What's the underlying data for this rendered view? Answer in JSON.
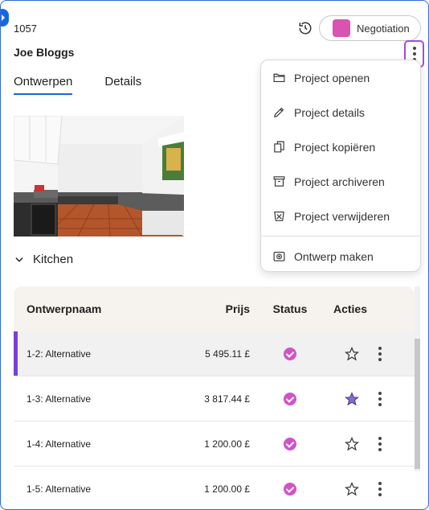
{
  "header": {
    "project_number": "1057",
    "client_name": "Joe Bloggs",
    "status_label": "Negotiation",
    "status_color": "#d953b3"
  },
  "tabs": [
    {
      "label": "Ontwerpen",
      "active": true
    },
    {
      "label": "Details",
      "active": false
    }
  ],
  "section": {
    "label": "Kitchen"
  },
  "table": {
    "columns": [
      "Ontwerpnaam",
      "Prijs",
      "Status",
      "Acties"
    ],
    "rows": [
      {
        "name": "1-2: Alternative",
        "price": "5 495.11 £",
        "selected": true,
        "starred": false
      },
      {
        "name": "1-3: Alternative",
        "price": "3 817.44 £",
        "selected": false,
        "starred": true
      },
      {
        "name": "1-4: Alternative",
        "price": "1 200.00 £",
        "selected": false,
        "starred": false
      },
      {
        "name": "1-5: Alternative",
        "price": "1 200.00 £",
        "selected": false,
        "starred": false
      }
    ]
  },
  "menu": {
    "items": [
      {
        "label": "Project openen",
        "icon": "folder-icon"
      },
      {
        "label": "Project details",
        "icon": "pencil-icon"
      },
      {
        "label": "Project kopiëren",
        "icon": "copy-icon"
      },
      {
        "label": "Project archiveren",
        "icon": "archive-icon"
      },
      {
        "label": "Project verwijderen",
        "icon": "trash-icon"
      },
      {
        "label": "Ontwerp maken",
        "icon": "create-design-icon"
      }
    ]
  },
  "colors": {
    "accent": "#1766e0",
    "selected_bar": "#7a3fd6",
    "status_check": "#d154c6",
    "star_filled": "#8c6ad8"
  }
}
